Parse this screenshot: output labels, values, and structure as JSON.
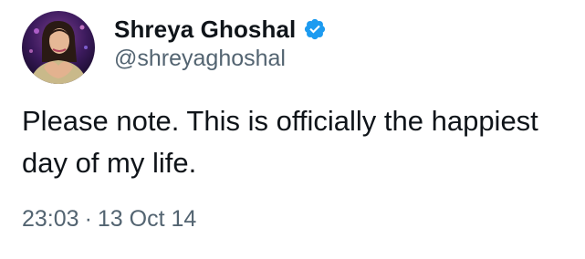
{
  "author": {
    "display_name": "Shreya Ghoshal",
    "handle": "@shreyaghoshal",
    "verified_icon": "verified-badge-icon",
    "verified_color": "#1d9bf0"
  },
  "tweet": {
    "text": "Please note. This is officially the happiest day of my life.",
    "time": "23:03",
    "separator": "·",
    "date": "13 Oct 14"
  },
  "colors": {
    "primary_text": "#0f1419",
    "secondary_text": "#536471",
    "background": "#ffffff"
  }
}
